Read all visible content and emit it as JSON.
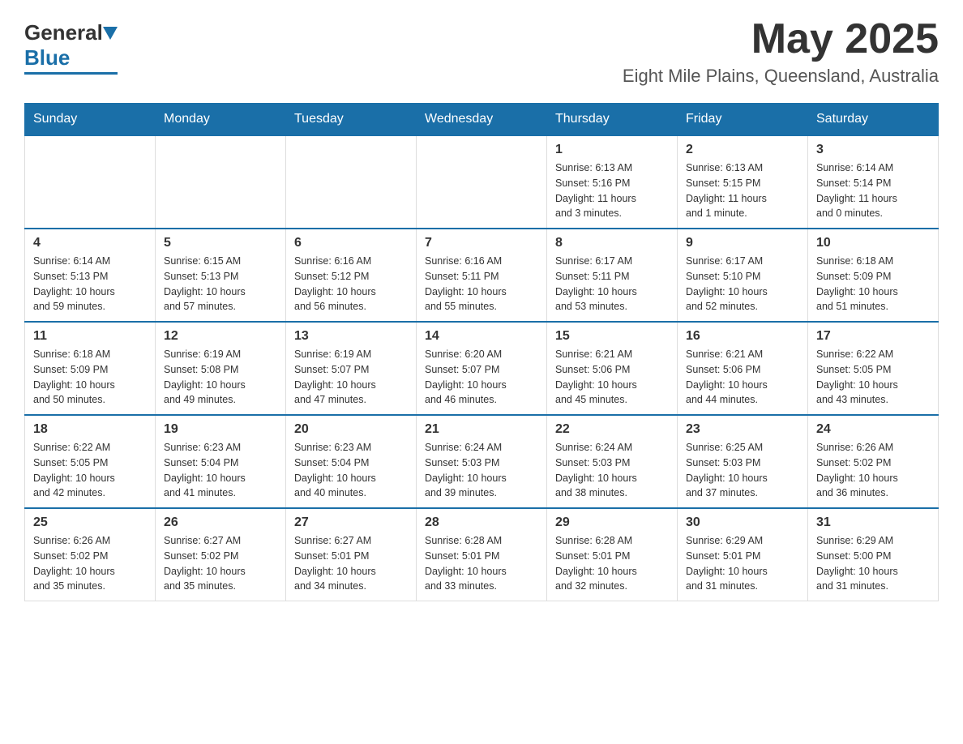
{
  "header": {
    "logo_general": "General",
    "logo_blue": "Blue",
    "month_title": "May 2025",
    "location": "Eight Mile Plains, Queensland, Australia"
  },
  "weekdays": [
    "Sunday",
    "Monday",
    "Tuesday",
    "Wednesday",
    "Thursday",
    "Friday",
    "Saturday"
  ],
  "weeks": [
    {
      "days": [
        {
          "date": "",
          "info": ""
        },
        {
          "date": "",
          "info": ""
        },
        {
          "date": "",
          "info": ""
        },
        {
          "date": "",
          "info": ""
        },
        {
          "date": "1",
          "info": "Sunrise: 6:13 AM\nSunset: 5:16 PM\nDaylight: 11 hours\nand 3 minutes."
        },
        {
          "date": "2",
          "info": "Sunrise: 6:13 AM\nSunset: 5:15 PM\nDaylight: 11 hours\nand 1 minute."
        },
        {
          "date": "3",
          "info": "Sunrise: 6:14 AM\nSunset: 5:14 PM\nDaylight: 11 hours\nand 0 minutes."
        }
      ]
    },
    {
      "days": [
        {
          "date": "4",
          "info": "Sunrise: 6:14 AM\nSunset: 5:13 PM\nDaylight: 10 hours\nand 59 minutes."
        },
        {
          "date": "5",
          "info": "Sunrise: 6:15 AM\nSunset: 5:13 PM\nDaylight: 10 hours\nand 57 minutes."
        },
        {
          "date": "6",
          "info": "Sunrise: 6:16 AM\nSunset: 5:12 PM\nDaylight: 10 hours\nand 56 minutes."
        },
        {
          "date": "7",
          "info": "Sunrise: 6:16 AM\nSunset: 5:11 PM\nDaylight: 10 hours\nand 55 minutes."
        },
        {
          "date": "8",
          "info": "Sunrise: 6:17 AM\nSunset: 5:11 PM\nDaylight: 10 hours\nand 53 minutes."
        },
        {
          "date": "9",
          "info": "Sunrise: 6:17 AM\nSunset: 5:10 PM\nDaylight: 10 hours\nand 52 minutes."
        },
        {
          "date": "10",
          "info": "Sunrise: 6:18 AM\nSunset: 5:09 PM\nDaylight: 10 hours\nand 51 minutes."
        }
      ]
    },
    {
      "days": [
        {
          "date": "11",
          "info": "Sunrise: 6:18 AM\nSunset: 5:09 PM\nDaylight: 10 hours\nand 50 minutes."
        },
        {
          "date": "12",
          "info": "Sunrise: 6:19 AM\nSunset: 5:08 PM\nDaylight: 10 hours\nand 49 minutes."
        },
        {
          "date": "13",
          "info": "Sunrise: 6:19 AM\nSunset: 5:07 PM\nDaylight: 10 hours\nand 47 minutes."
        },
        {
          "date": "14",
          "info": "Sunrise: 6:20 AM\nSunset: 5:07 PM\nDaylight: 10 hours\nand 46 minutes."
        },
        {
          "date": "15",
          "info": "Sunrise: 6:21 AM\nSunset: 5:06 PM\nDaylight: 10 hours\nand 45 minutes."
        },
        {
          "date": "16",
          "info": "Sunrise: 6:21 AM\nSunset: 5:06 PM\nDaylight: 10 hours\nand 44 minutes."
        },
        {
          "date": "17",
          "info": "Sunrise: 6:22 AM\nSunset: 5:05 PM\nDaylight: 10 hours\nand 43 minutes."
        }
      ]
    },
    {
      "days": [
        {
          "date": "18",
          "info": "Sunrise: 6:22 AM\nSunset: 5:05 PM\nDaylight: 10 hours\nand 42 minutes."
        },
        {
          "date": "19",
          "info": "Sunrise: 6:23 AM\nSunset: 5:04 PM\nDaylight: 10 hours\nand 41 minutes."
        },
        {
          "date": "20",
          "info": "Sunrise: 6:23 AM\nSunset: 5:04 PM\nDaylight: 10 hours\nand 40 minutes."
        },
        {
          "date": "21",
          "info": "Sunrise: 6:24 AM\nSunset: 5:03 PM\nDaylight: 10 hours\nand 39 minutes."
        },
        {
          "date": "22",
          "info": "Sunrise: 6:24 AM\nSunset: 5:03 PM\nDaylight: 10 hours\nand 38 minutes."
        },
        {
          "date": "23",
          "info": "Sunrise: 6:25 AM\nSunset: 5:03 PM\nDaylight: 10 hours\nand 37 minutes."
        },
        {
          "date": "24",
          "info": "Sunrise: 6:26 AM\nSunset: 5:02 PM\nDaylight: 10 hours\nand 36 minutes."
        }
      ]
    },
    {
      "days": [
        {
          "date": "25",
          "info": "Sunrise: 6:26 AM\nSunset: 5:02 PM\nDaylight: 10 hours\nand 35 minutes."
        },
        {
          "date": "26",
          "info": "Sunrise: 6:27 AM\nSunset: 5:02 PM\nDaylight: 10 hours\nand 35 minutes."
        },
        {
          "date": "27",
          "info": "Sunrise: 6:27 AM\nSunset: 5:01 PM\nDaylight: 10 hours\nand 34 minutes."
        },
        {
          "date": "28",
          "info": "Sunrise: 6:28 AM\nSunset: 5:01 PM\nDaylight: 10 hours\nand 33 minutes."
        },
        {
          "date": "29",
          "info": "Sunrise: 6:28 AM\nSunset: 5:01 PM\nDaylight: 10 hours\nand 32 minutes."
        },
        {
          "date": "30",
          "info": "Sunrise: 6:29 AM\nSunset: 5:01 PM\nDaylight: 10 hours\nand 31 minutes."
        },
        {
          "date": "31",
          "info": "Sunrise: 6:29 AM\nSunset: 5:00 PM\nDaylight: 10 hours\nand 31 minutes."
        }
      ]
    }
  ]
}
